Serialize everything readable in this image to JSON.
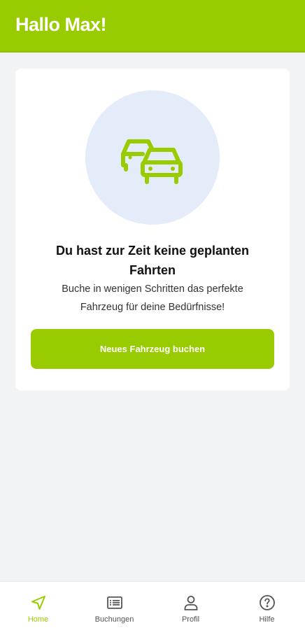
{
  "header": {
    "title": "Hallo Max!"
  },
  "empty_state": {
    "illustration_icon": "cars-icon",
    "title": "Du hast zur Zeit keine geplanten Fahrten",
    "subtitle": "Buche in wenigen Schritten das perfekte Fahrzeug für deine Bedürfnisse!",
    "button_label": "Neues Fahrzeug buchen"
  },
  "bottom_nav": {
    "items": [
      {
        "label": "Home",
        "icon": "navigation-arrow-icon",
        "active": true
      },
      {
        "label": "Buchungen",
        "icon": "list-icon",
        "active": false
      },
      {
        "label": "Profil",
        "icon": "person-icon",
        "active": false
      },
      {
        "label": "Hilfe",
        "icon": "help-circle-icon",
        "active": false
      }
    ]
  },
  "colors": {
    "brand": "#99cc00",
    "illustration_bg": "#e4ecfa",
    "page_bg": "#f2f3f5",
    "inactive_nav": "#555555"
  }
}
